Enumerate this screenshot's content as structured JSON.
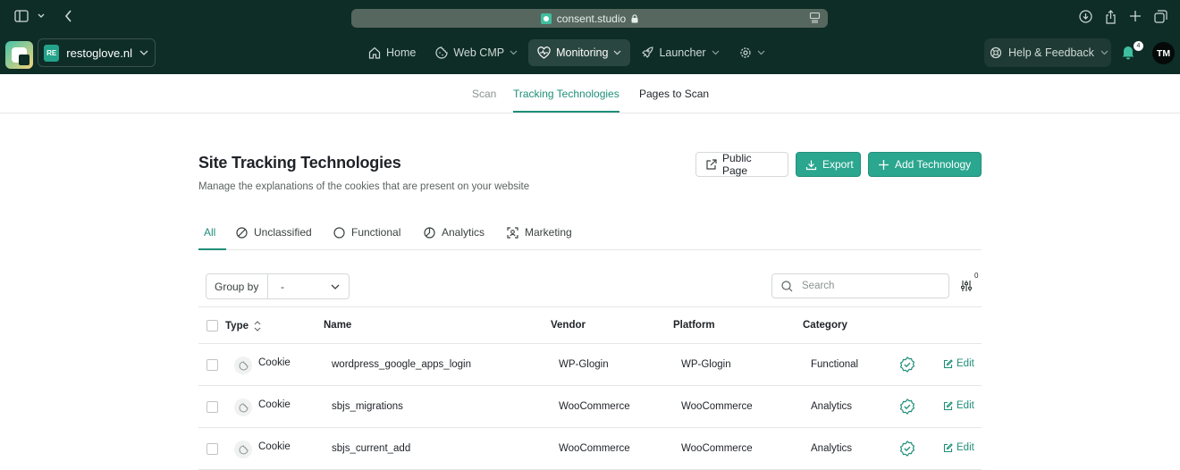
{
  "browser": {
    "url": "consent.studio"
  },
  "nav": {
    "site_badge": "RE",
    "site_name": "restoglove.nl",
    "items": [
      {
        "label": "Home",
        "icon": "home-icon"
      },
      {
        "label": "Web CMP",
        "icon": "cookie-icon"
      },
      {
        "label": "Monitoring",
        "icon": "heart-pulse-icon"
      },
      {
        "label": "Launcher",
        "icon": "rocket-icon"
      }
    ],
    "help_label": "Help & Feedback",
    "notification_count": "4",
    "avatar_initials": "TM"
  },
  "subtabs": [
    {
      "label": "Scan"
    },
    {
      "label": "Tracking Technologies"
    },
    {
      "label": "Pages to Scan"
    }
  ],
  "page": {
    "title": "Site Tracking Technologies",
    "subtitle": "Manage the explanations of the cookies that are present on your website",
    "public_page_label": "Public Page",
    "export_label": "Export",
    "add_label": "Add Technology"
  },
  "filter_tabs": [
    {
      "label": "All"
    },
    {
      "label": "Unclassified",
      "icon": "ban-icon"
    },
    {
      "label": "Functional",
      "icon": "circle-icon"
    },
    {
      "label": "Analytics",
      "icon": "pie-chart-icon"
    },
    {
      "label": "Marketing",
      "icon": "scan-face-icon"
    }
  ],
  "toolbar": {
    "group_by_label": "Group by",
    "group_by_value": "-",
    "search_placeholder": "Search",
    "filter_count": "0"
  },
  "table": {
    "columns": [
      "Type",
      "Name",
      "Vendor",
      "Platform",
      "Category"
    ],
    "edit_label": "Edit",
    "rows": [
      {
        "type": "Cookie",
        "name": "wordpress_google_apps_login",
        "vendor": "WP-Glogin",
        "platform": "WP-Glogin",
        "category": "Functional"
      },
      {
        "type": "Cookie",
        "name": "sbjs_migrations",
        "vendor": "WooCommerce",
        "platform": "WooCommerce",
        "category": "Analytics"
      },
      {
        "type": "Cookie",
        "name": "sbjs_current_add",
        "vendor": "WooCommerce",
        "platform": "WooCommerce",
        "category": "Analytics"
      }
    ]
  },
  "colors": {
    "brand_dark": "#0e2d27",
    "accent": "#2ba68f",
    "accent_text": "#1f8f79"
  }
}
